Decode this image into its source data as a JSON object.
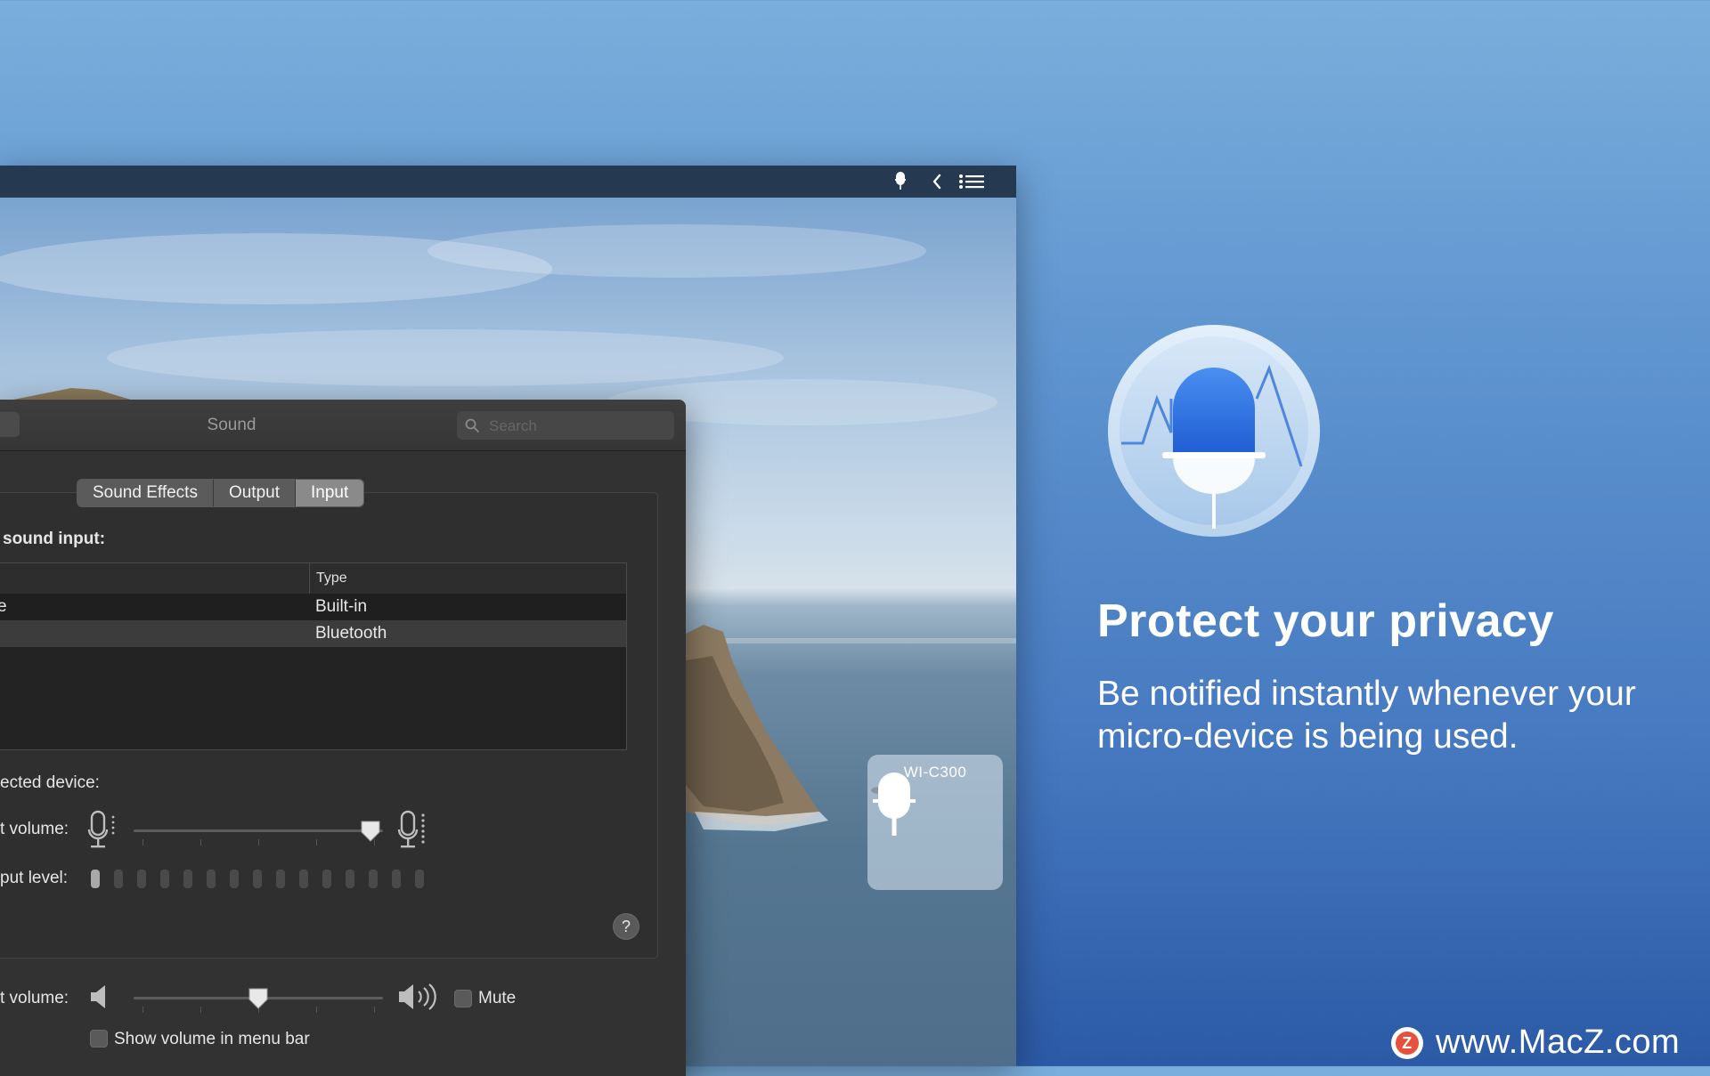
{
  "menubar": {
    "icons": [
      "microphone-icon",
      "chevron-left-icon",
      "list-icon"
    ]
  },
  "mic_popup": {
    "device_name": "WI-C300"
  },
  "sound_window": {
    "title": "Sound",
    "search_placeholder": "Search",
    "tabs": [
      {
        "label": "Sound Effects",
        "active": false
      },
      {
        "label": "Output",
        "active": false
      },
      {
        "label": "Input",
        "active": true
      }
    ],
    "select_label": "sound input:",
    "table": {
      "columns": [
        "",
        "Type"
      ],
      "rows": [
        {
          "name": "e",
          "type": "Built-in"
        },
        {
          "name": "",
          "type": "Bluetooth"
        }
      ]
    },
    "settings_label": "ected device:",
    "input_volume_label": "t volume:",
    "input_volume_value": 0.95,
    "input_level_label": "put level:",
    "input_level_lit_bars": 1,
    "input_level_total_bars": 15,
    "help_label": "?",
    "output_volume_label": "t volume:",
    "output_volume_value": 0.5,
    "mute_label": "Mute",
    "mute_checked": false,
    "show_volume_label": "Show volume in menu bar",
    "show_volume_checked": false
  },
  "promo": {
    "headline": "Protect your privacy",
    "subline": "Be notified instantly whenever your micro-device is being used."
  },
  "watermark": {
    "logo_letter": "Z",
    "text": "www.MacZ.com"
  },
  "colors": {
    "background_top": "#7aaedc",
    "background_bottom": "#2c5aa6",
    "menubar": "#253a50",
    "window": "#323232",
    "app_icon_blue": "#2f6ee0"
  }
}
